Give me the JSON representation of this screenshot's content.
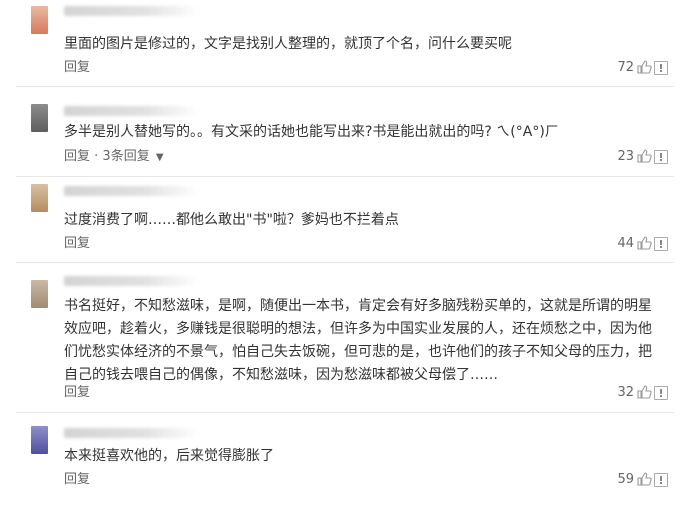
{
  "comments": [
    {
      "text": "里面的图片是修过的，文字是找别人整理的，就顶了个名，问什么要买呢",
      "reply_label": "回复",
      "replies_label": "",
      "likes": "72",
      "avatar_colors": [
        "#e8b8a3",
        "#d77a5a"
      ]
    },
    {
      "text": "多半是别人替她写的。。有文采的话她也能写出来?书是能出就出的吗? ㄟ(°A°)ㄏ",
      "reply_label": "回复",
      "replies_label": "3条回复",
      "likes": "23",
      "avatar_colors": [
        "#8c8c8c",
        "#5e5e5e"
      ]
    },
    {
      "text": "过度消费了啊……都他么敢出\"书\"啦？爹妈也不拦着点",
      "reply_label": "回复",
      "replies_label": "",
      "likes": "44",
      "avatar_colors": [
        "#d7c1a3",
        "#b58c5f"
      ]
    },
    {
      "text": "书名挺好，不知愁滋味，是啊，随便出一本书，肯定会有好多脑残粉买单的，这就是所谓的明星效应吧，趁着火，多赚钱是很聪明的想法，但许多为中国实业发展的人，还在烦愁之中，因为他们忧愁实体经济的不景气，怕自己失去饭碗，但可悲的是，也许他们的孩子不知父母的压力，把自己的钱去喂自己的偶像，不知愁滋味，因为愁滋味都被父母偿了……",
      "reply_label": "回复",
      "replies_label": "",
      "likes": "32",
      "avatar_colors": [
        "#c9b9a6",
        "#a08b73"
      ]
    },
    {
      "text": "本来挺喜欢他的，后来觉得膨胀了",
      "reply_label": "回复",
      "replies_label": "",
      "likes": "59",
      "avatar_colors": [
        "#8f8fc9",
        "#4f4f9e"
      ]
    }
  ],
  "icons": {
    "like": "thumbs-up-icon",
    "report": "report-icon"
  },
  "colors": {
    "text": "#333333",
    "meta": "#666666",
    "divider": "#e6e6e6"
  }
}
